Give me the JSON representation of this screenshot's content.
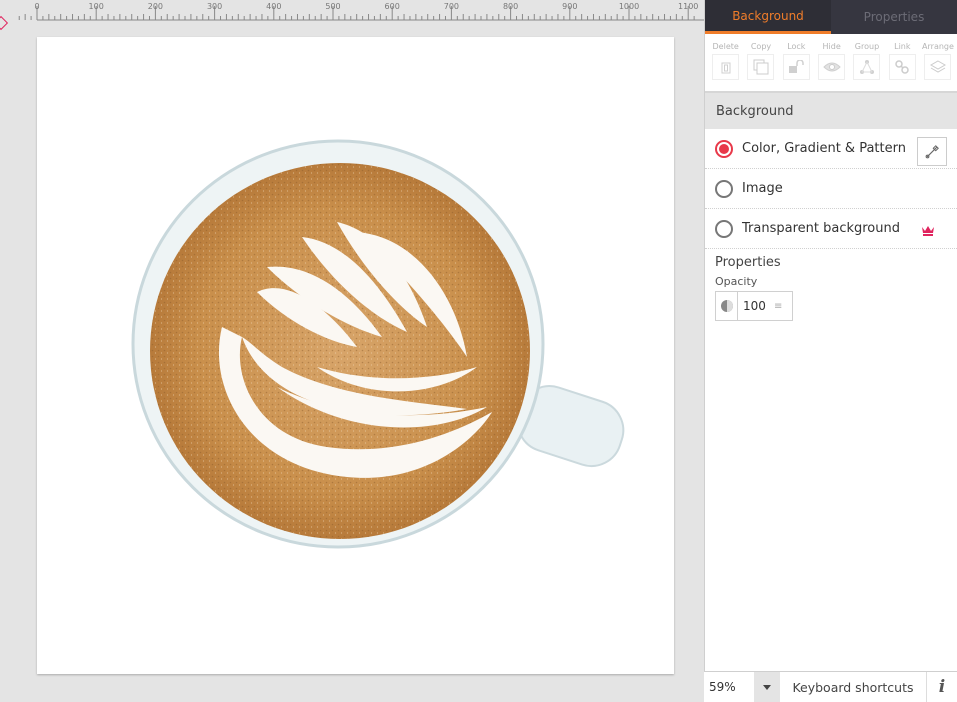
{
  "ruler": {
    "labels": [
      "0",
      "100",
      "200",
      "300",
      "400",
      "500",
      "600",
      "700",
      "800",
      "900",
      "1000",
      "1100"
    ]
  },
  "canvas": {
    "image_description": "Top-down photo of a latte with rosetta latte art in a white cup"
  },
  "panel": {
    "tabs": [
      {
        "label": "Background",
        "active": true
      },
      {
        "label": "Properties",
        "active": false
      }
    ],
    "toolbar": [
      {
        "label": "Delete",
        "icon": "trash-icon"
      },
      {
        "label": "Copy",
        "icon": "copy-icon"
      },
      {
        "label": "Lock",
        "icon": "unlock-icon"
      },
      {
        "label": "Hide",
        "icon": "eye-icon"
      },
      {
        "label": "Group",
        "icon": "group-icon"
      },
      {
        "label": "Link",
        "icon": "link-icon"
      },
      {
        "label": "Arrange",
        "icon": "layers-icon"
      }
    ],
    "section_title": "Background",
    "options": [
      {
        "label": "Color, Gradient & Pattern",
        "checked": true
      },
      {
        "label": "Image",
        "checked": false
      },
      {
        "label": "Transparent background",
        "checked": false,
        "premium": true
      }
    ],
    "properties_title": "Properties",
    "opacity_label": "Opacity",
    "opacity_value": "100",
    "accent_color": "#f07d2a",
    "radio_color": "#e8394a",
    "premium_color": "#e0245e"
  },
  "statusbar": {
    "zoom": "59%",
    "shortcuts_label": "Keyboard shortcuts",
    "info_label": "i"
  }
}
